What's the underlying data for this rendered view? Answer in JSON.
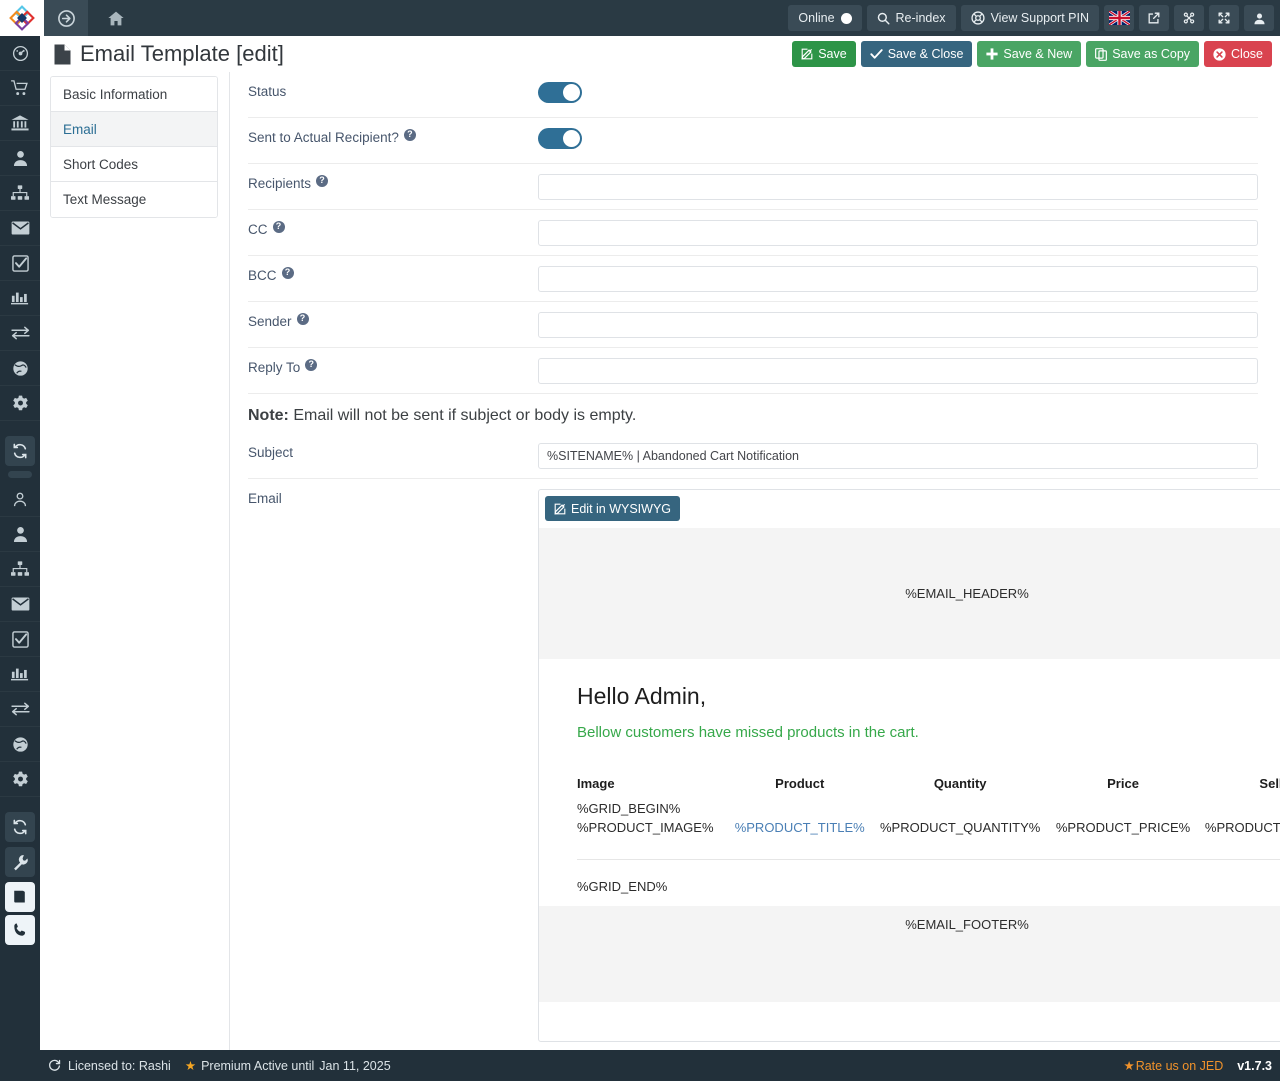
{
  "topbar": {
    "logo_icon": "joomla-logo-icon",
    "forward_icon": "arrow-circle-right-icon",
    "home_icon": "home-icon",
    "online_label": "Online",
    "reindex_label": "Re-index",
    "support_pin_label": "View Support PIN",
    "flag_icon": "uk-flag-icon",
    "external_icon": "external-link-icon",
    "joomla_icon": "joomla-icon",
    "expand_icon": "expand-arrows-icon",
    "user_icon": "user-icon"
  },
  "rail": {
    "items": [
      {
        "icon": "dashboard-icon",
        "name": "rail-item-dashboard"
      },
      {
        "icon": "cart-icon",
        "name": "rail-item-orders"
      },
      {
        "icon": "bank-icon",
        "name": "rail-item-store"
      },
      {
        "icon": "user-icon",
        "name": "rail-item-customers"
      },
      {
        "icon": "sitemap-icon",
        "name": "rail-item-categories"
      },
      {
        "icon": "envelope-icon",
        "name": "rail-item-emails"
      },
      {
        "icon": "check-square-icon",
        "name": "rail-item-tasks"
      },
      {
        "icon": "bar-chart-icon",
        "name": "rail-item-reports"
      },
      {
        "icon": "exchange-icon",
        "name": "rail-item-transactions"
      },
      {
        "icon": "globe-icon",
        "name": "rail-item-locations"
      },
      {
        "icon": "gear-icon",
        "name": "rail-item-settings"
      }
    ],
    "items2": [
      {
        "icon": "user-outline-icon",
        "name": "rail-item-profile"
      },
      {
        "icon": "user-icon",
        "name": "rail-item-users"
      },
      {
        "icon": "sitemap-icon",
        "name": "rail-item-structure"
      },
      {
        "icon": "envelope-icon",
        "name": "rail-item-mail"
      },
      {
        "icon": "check-square-icon",
        "name": "rail-item-approvals"
      },
      {
        "icon": "bar-chart-icon",
        "name": "rail-item-analytics"
      },
      {
        "icon": "exchange-icon",
        "name": "rail-item-sync"
      },
      {
        "icon": "globe-icon",
        "name": "rail-item-web"
      },
      {
        "icon": "gear-icon",
        "name": "rail-item-config"
      }
    ],
    "sync_icon": "refresh-icon",
    "wrench_icon": "wrench-icon",
    "book_icon": "book-icon",
    "phone_icon": "phone-icon"
  },
  "header": {
    "title": "Email Template [edit]",
    "page_icon": "document-icon",
    "buttons": [
      {
        "label": "Save",
        "icon": "edit-icon",
        "style": "green",
        "name": "save-button"
      },
      {
        "label": "Save & Close",
        "icon": "check-icon",
        "style": "blue",
        "name": "save-and-close-button"
      },
      {
        "label": "Save & New",
        "icon": "plus-icon",
        "style": "green2",
        "name": "save-and-new-button"
      },
      {
        "label": "Save as Copy",
        "icon": "copy-icon",
        "style": "green2",
        "name": "save-as-copy-button"
      },
      {
        "label": "Close",
        "icon": "close-circle-icon",
        "style": "red",
        "name": "close-button"
      }
    ]
  },
  "tabs": [
    {
      "label": "Basic Information",
      "active": false
    },
    {
      "label": "Email",
      "active": true
    },
    {
      "label": "Short Codes",
      "active": false
    },
    {
      "label": "Text Message",
      "active": false
    }
  ],
  "form": {
    "status": {
      "label": "Status",
      "value": "on",
      "has_help": false
    },
    "sent_to_actual": {
      "label": "Sent to Actual Recipient?",
      "value": "on",
      "has_help": true
    },
    "recipients": {
      "label": "Recipients",
      "value": "",
      "placeholder": "",
      "has_help": true
    },
    "cc": {
      "label": "CC",
      "value": "",
      "placeholder": "",
      "has_help": true
    },
    "bcc": {
      "label": "BCC",
      "value": "",
      "placeholder": "",
      "has_help": true
    },
    "sender": {
      "label": "Sender",
      "value": "",
      "placeholder": "",
      "has_help": true
    },
    "reply_to": {
      "label": "Reply To",
      "value": "",
      "placeholder": "",
      "has_help": true
    },
    "note_bold": "Note:",
    "note_text": "Email will not be sent if subject or body is empty.",
    "subject": {
      "label": "Subject",
      "value": "%SITENAME% | Abandoned Cart Notification",
      "placeholder": ""
    },
    "email": {
      "label": "Email"
    },
    "wysiwyg_label": "Edit in WYSIWYG",
    "wysiwyg_icon": "edit-icon"
  },
  "preview": {
    "header_token": "%EMAIL_HEADER%",
    "greeting": "Hello Admin,",
    "intro": "Bellow customers have missed products in the cart.",
    "table": {
      "columns": [
        "Image",
        "Product",
        "Quantity",
        "Price",
        "Seller"
      ],
      "grid_begin": "%GRID_BEGIN%",
      "grid_end": "%GRID_END%",
      "row": [
        "%PRODUCT_IMAGE%",
        "%PRODUCT_TITLE%",
        "%PRODUCT_QUANTITY%",
        "%PRODUCT_PRICE%",
        "%PRODUCT_SELLER%"
      ]
    },
    "footer_token": "%EMAIL_FOOTER%"
  },
  "statusbar": {
    "refresh_icon": "refresh-icon",
    "licensed_to": "Licensed to: Rashi",
    "star_icon": "star-icon",
    "premium_text": "Premium Active until",
    "premium_date": "Jan 11, 2025",
    "rate_label": "Rate us on JED",
    "version": "v1.7.3"
  },
  "colors": {
    "topbar_bg": "#2a3a44",
    "rail_bg": "#22303a",
    "accent_blue": "#2f6f96",
    "green": "#2d9447",
    "red": "#d9434f",
    "link_blue": "#2b6e94",
    "mail_green": "#36a84a",
    "orange": "#f0922b"
  }
}
